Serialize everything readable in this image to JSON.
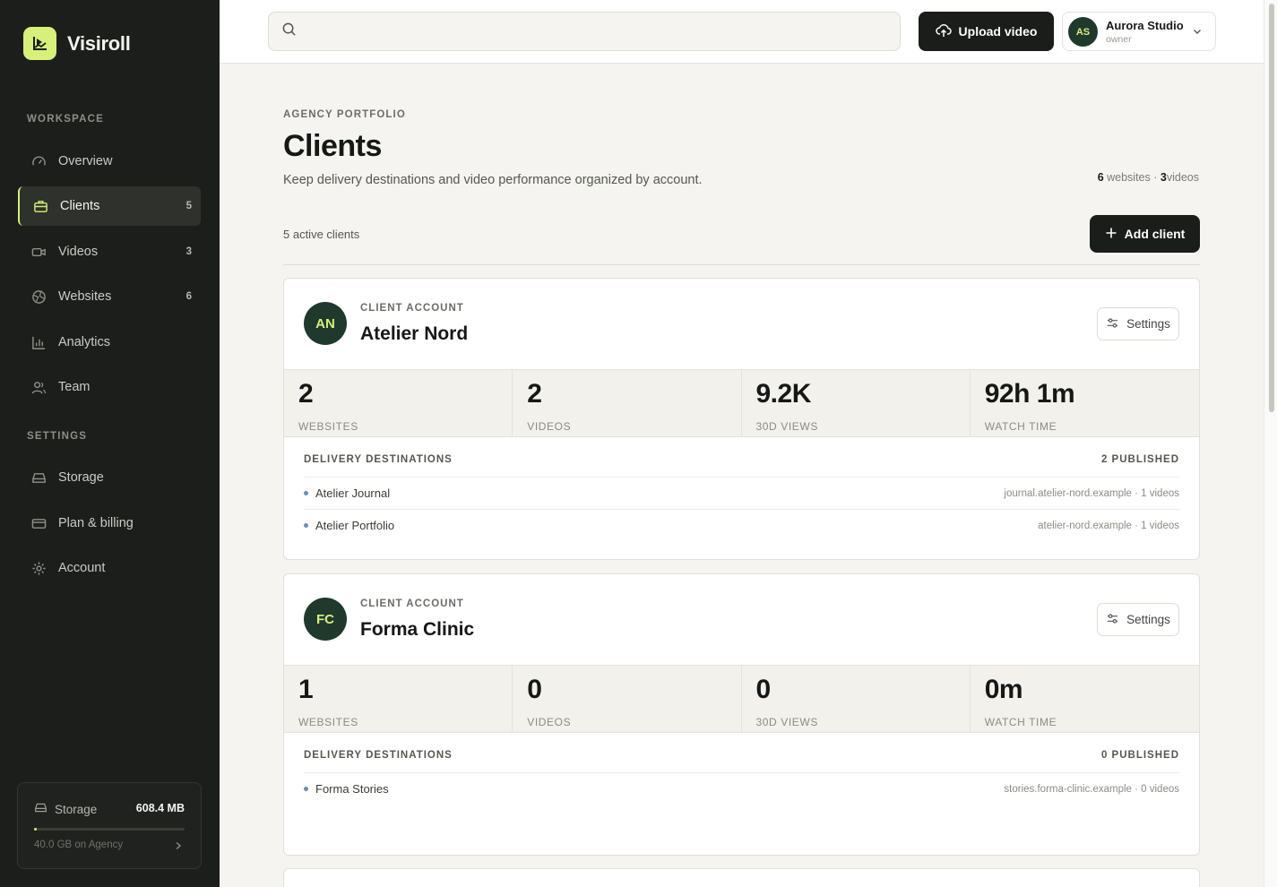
{
  "brand": {
    "name": "Visiroll"
  },
  "sidebar": {
    "workspace_label": "WORKSPACE",
    "settings_label": "SETTINGS",
    "workspace_items": [
      {
        "label": "Overview",
        "icon": "gauge-icon",
        "count": ""
      },
      {
        "label": "Clients",
        "icon": "briefcase-icon",
        "count": "5",
        "active": true
      },
      {
        "label": "Videos",
        "icon": "video-camera-icon",
        "count": "3"
      },
      {
        "label": "Websites",
        "icon": "globe-icon",
        "count": "6"
      },
      {
        "label": "Analytics",
        "icon": "bar-chart-icon",
        "count": ""
      },
      {
        "label": "Team",
        "icon": "users-icon",
        "count": ""
      }
    ],
    "settings_items": [
      {
        "label": "Storage",
        "icon": "hard-drive-icon"
      },
      {
        "label": "Plan & billing",
        "icon": "credit-card-icon"
      },
      {
        "label": "Account",
        "icon": "gear-icon"
      }
    ],
    "storage": {
      "label": "Storage",
      "size": "608.4 MB",
      "plan": "40.0 GB on Agency",
      "used_fraction": 0.015
    }
  },
  "topbar": {
    "search_placeholder": "",
    "upload_label": "Upload video",
    "account": {
      "initials": "AS",
      "name": "Aurora Studio",
      "role": "owner"
    }
  },
  "page": {
    "eyebrow": "AGENCY PORTFOLIO",
    "title": "Clients",
    "subtitle": "Keep delivery destinations and video performance organized by account.",
    "summary": {
      "websites": "6",
      "websites_word": "websites",
      "sep": "·",
      "videos": "3",
      "videos_word": "videos"
    },
    "active_count": "5 active clients",
    "add_client_label": "Add client"
  },
  "clients": [
    {
      "initials": "AN",
      "kicker": "CLIENT ACCOUNT",
      "name": "Atelier Nord",
      "settings_label": "Settings",
      "stats": [
        {
          "value": "2",
          "label": "WEBSITES"
        },
        {
          "value": "2",
          "label": "VIDEOS"
        },
        {
          "value": "9.2K",
          "label": "30D VIEWS"
        },
        {
          "value": "92h 1m",
          "label": "WATCH TIME"
        }
      ],
      "destinations_label": "DELIVERY DESTINATIONS",
      "published_label": "2 PUBLISHED",
      "destinations": [
        {
          "name": "Atelier Journal",
          "meta": "journal.atelier-nord.example · 1 videos"
        },
        {
          "name": "Atelier Portfolio",
          "meta": "atelier-nord.example · 1 videos"
        }
      ]
    },
    {
      "initials": "FC",
      "kicker": "CLIENT ACCOUNT",
      "name": "Forma Clinic",
      "settings_label": "Settings",
      "stats": [
        {
          "value": "1",
          "label": "WEBSITES"
        },
        {
          "value": "0",
          "label": "VIDEOS"
        },
        {
          "value": "0",
          "label": "30D VIEWS"
        },
        {
          "value": "0m",
          "label": "WATCH TIME"
        }
      ],
      "destinations_label": "DELIVERY DESTINATIONS",
      "published_label": "0 PUBLISHED",
      "destinations": [
        {
          "name": "Forma Stories",
          "meta": "stories.forma-clinic.example · 0 videos"
        }
      ]
    }
  ],
  "colors": {
    "accent": "#d6f07a",
    "sidebar_bg": "#1c1e1b",
    "avatar_bg": "#1f3a2d",
    "dest_dot": "#6a8fb3"
  }
}
